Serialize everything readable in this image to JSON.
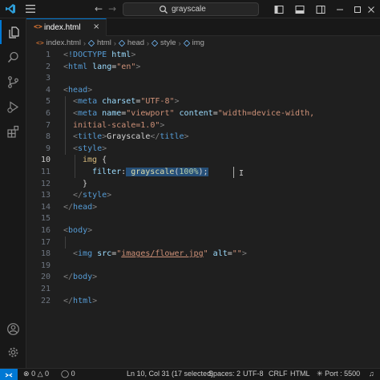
{
  "titlebar": {
    "search_text": "grayscale",
    "back_icon": "arrow-left-icon",
    "forward_icon": "arrow-right-icon"
  },
  "activity_bar": {
    "items": [
      "explorer-icon",
      "search-icon",
      "source-control-icon",
      "run-debug-icon",
      "extensions-icon"
    ],
    "bottom": [
      "account-icon",
      "settings-gear-icon"
    ]
  },
  "tab": {
    "label": "index.html",
    "icon_text": "<>",
    "close": "×"
  },
  "breadcrumb": {
    "file": "index.html",
    "segments": [
      "html",
      "head",
      "style",
      "img"
    ]
  },
  "editor": {
    "active_line": 10,
    "lines": [
      {
        "n": "1"
      },
      {
        "n": "2"
      },
      {
        "n": "3"
      },
      {
        "n": "4"
      },
      {
        "n": "5"
      },
      {
        "n": "6"
      },
      {
        "n": "7"
      },
      {
        "n": "8"
      },
      {
        "n": "9"
      },
      {
        "n": "10"
      },
      {
        "n": "11"
      },
      {
        "n": "12"
      },
      {
        "n": "13"
      },
      {
        "n": "14"
      },
      {
        "n": "15"
      },
      {
        "n": "16"
      },
      {
        "n": "17"
      },
      {
        "n": "18"
      },
      {
        "n": "19"
      },
      {
        "n": "20"
      },
      {
        "n": "21"
      },
      {
        "n": "22"
      }
    ],
    "code": {
      "doctype": "!DOCTYPE",
      "html_word": "html",
      "lang_attr": "lang",
      "lang_val": "\"en\"",
      "head": "head",
      "meta": "meta",
      "charset_attr": "charset",
      "charset_val": "\"UTF-8\"",
      "name_attr": "name",
      "name_val": "\"viewport\"",
      "content_attr": "content",
      "content_val1": "\"width=device-width,",
      "content_val2": "initial-scale=1.0\"",
      "title": "title",
      "title_text": "Grayscale",
      "style": "style",
      "selector": "img",
      "property": "filter",
      "fn": "grayscale",
      "num": "100%",
      "body": "body",
      "img": "img",
      "src_attr": "src",
      "src_val": "images/flower.jpg",
      "alt_attr": "alt",
      "alt_val": "\"\""
    }
  },
  "statusbar": {
    "errors": "0",
    "warnings": "0",
    "info": "0",
    "cursor": "Ln 10, Col 31 (17 selected)",
    "spaces": "Spaces: 2",
    "encoding": "UTF-8",
    "eol": "CRLF",
    "language": "HTML",
    "port": "Port : 5500"
  },
  "colors": {
    "accent": "#0078d4",
    "background": "#1f1f1f",
    "selection": "#264f78"
  }
}
